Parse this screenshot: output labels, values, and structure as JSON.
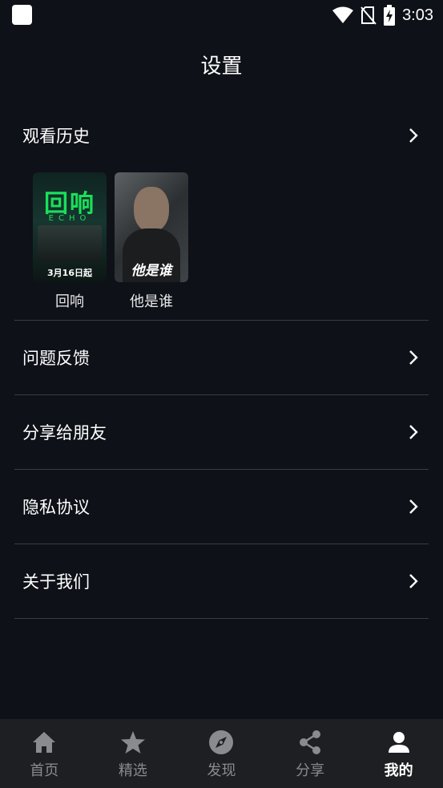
{
  "status_bar": {
    "time": "3:03"
  },
  "header": {
    "title": "设置"
  },
  "history": {
    "label": "观看历史",
    "items": [
      {
        "title": "回响",
        "poster_logo": "回响",
        "poster_sub": "ECHO",
        "poster_date": "3月16日起"
      },
      {
        "title": "他是谁",
        "poster_logo": "他是谁"
      }
    ]
  },
  "menu": [
    {
      "label": "问题反馈"
    },
    {
      "label": "分享给朋友"
    },
    {
      "label": "隐私协议"
    },
    {
      "label": "关于我们"
    }
  ],
  "bottom_nav": [
    {
      "label": "首页",
      "icon": "home-icon"
    },
    {
      "label": "精选",
      "icon": "star-icon"
    },
    {
      "label": "发现",
      "icon": "compass-icon"
    },
    {
      "label": "分享",
      "icon": "share-icon"
    },
    {
      "label": "我的",
      "icon": "person-icon",
      "active": true
    }
  ],
  "colors": {
    "background": "#0e1118",
    "nav_background": "#1e1f22",
    "inactive": "#8a8b8e",
    "active": "#ffffff"
  }
}
